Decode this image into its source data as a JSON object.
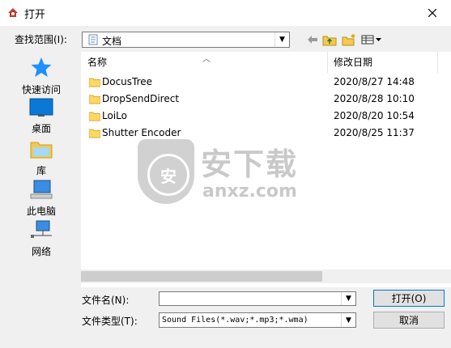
{
  "window": {
    "title": "打开"
  },
  "lookin": {
    "label": "查找范围(I):",
    "value": "文档"
  },
  "places": [
    {
      "label": "快速访问",
      "icon": "star-icon"
    },
    {
      "label": "桌面",
      "icon": "desktop-icon"
    },
    {
      "label": "库",
      "icon": "library-icon"
    },
    {
      "label": "此电脑",
      "icon": "computer-icon"
    },
    {
      "label": "网络",
      "icon": "network-icon"
    }
  ],
  "columns": {
    "name": "名称",
    "modified": "修改日期"
  },
  "files": [
    {
      "name": "DocusTree",
      "modified": "2020/8/27 14:48"
    },
    {
      "name": "DropSendDirect",
      "modified": "2020/8/28 10:10"
    },
    {
      "name": "LoiLo",
      "modified": "2020/8/20 10:54"
    },
    {
      "name": "Shutter Encoder",
      "modified": "2020/8/25 11:37"
    }
  ],
  "watermark": {
    "title": "安下载",
    "sub": "anxz.com",
    "badge": "安"
  },
  "form": {
    "filename_label": "文件名(N):",
    "filename_value": "",
    "filetype_label": "文件类型(T):",
    "filetype_value": "Sound Files(*.wav;*.mp3;*.wma)"
  },
  "buttons": {
    "open": "打开(O)",
    "cancel": "取消"
  },
  "colors": {
    "folder": "#ffd866",
    "accent": "#0078d7",
    "star": "#1e90ff"
  }
}
